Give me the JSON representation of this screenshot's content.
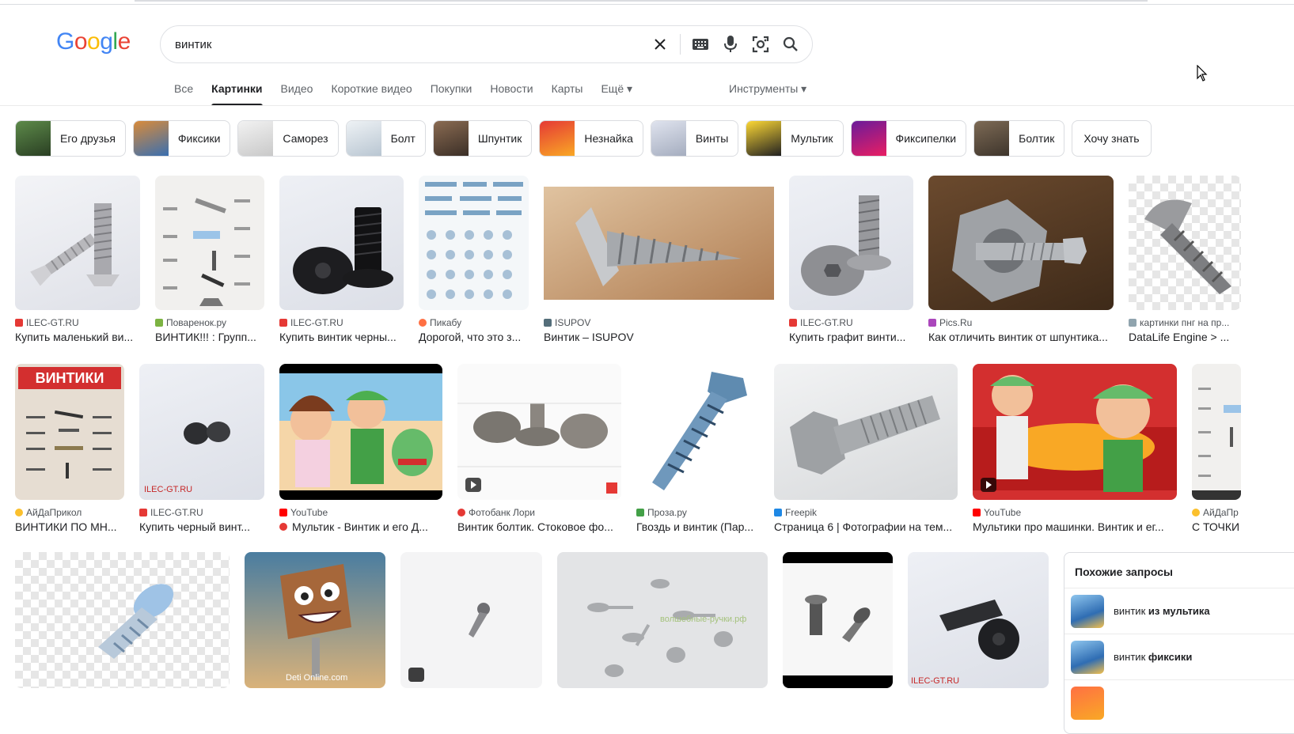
{
  "logo": {
    "letters": [
      "G",
      "o",
      "o",
      "g",
      "l",
      "e"
    ],
    "colors": [
      "#4285F4",
      "#EA4335",
      "#FBBC05",
      "#4285F4",
      "#34A853",
      "#EA4335"
    ]
  },
  "search": {
    "value": "винтик"
  },
  "tabs": [
    "Все",
    "Картинки",
    "Видео",
    "Короткие видео",
    "Покупки",
    "Новости",
    "Карты",
    "Ещё ▾"
  ],
  "active_tab": "Картинки",
  "tools_label": "Инструменты ▾",
  "chips": [
    "Его друзья",
    "Фиксики",
    "Саморез",
    "Болт",
    "Шпунтик",
    "Незнайка",
    "Винты",
    "Мультик",
    "Фиксипелки",
    "Болтик",
    "Хочу знать"
  ],
  "row1": [
    {
      "source": "ILEC-GT.RU",
      "title": "Купить маленький ви..."
    },
    {
      "source": "Поваренок.ру",
      "title": "ВИНТИК!!! : Групп..."
    },
    {
      "source": "ILEC-GT.RU",
      "title": "Купить винтик черны..."
    },
    {
      "source": "Пикабу",
      "title": "Дорогой, что это з..."
    },
    {
      "source": "ISUPOV",
      "title": "Винтик – ISUPOV"
    },
    {
      "source": "ILEC-GT.RU",
      "title": "Купить графит винти..."
    },
    {
      "source": "Pics.Ru",
      "title": "Как отличить винтик от шпунтика..."
    },
    {
      "source": "картинки пнг на пр...",
      "title": "DataLife Engine > ..."
    }
  ],
  "row2": [
    {
      "source": "АйДаПрикол",
      "title": "ВИНТИКИ ПО МН...",
      "overlay": "ВИНТИКИ"
    },
    {
      "source": "ILEC-GT.RU",
      "title": "Купить черный винт..."
    },
    {
      "source": "YouTube",
      "title": "Мультик - Винтик и его Д..."
    },
    {
      "source": "Фотобанк Лори",
      "title": "Винтик болтик. Стоковое фо..."
    },
    {
      "source": "Проза.ру",
      "title": "Гвоздь и винтик (Пар..."
    },
    {
      "source": "Freepik",
      "title": "Страница 6 | Фотографии на тем..."
    },
    {
      "source": "YouTube",
      "title": "Мультики про машинки. Винтик и ег..."
    },
    {
      "source": "АйДаПр",
      "title": "С ТОЧКИ"
    }
  ],
  "related": {
    "heading": "Похожие запросы",
    "items": [
      {
        "prefix": "винтик",
        "bold": "из мультика"
      },
      {
        "prefix": "винтик",
        "bold": "фиксики"
      }
    ]
  }
}
